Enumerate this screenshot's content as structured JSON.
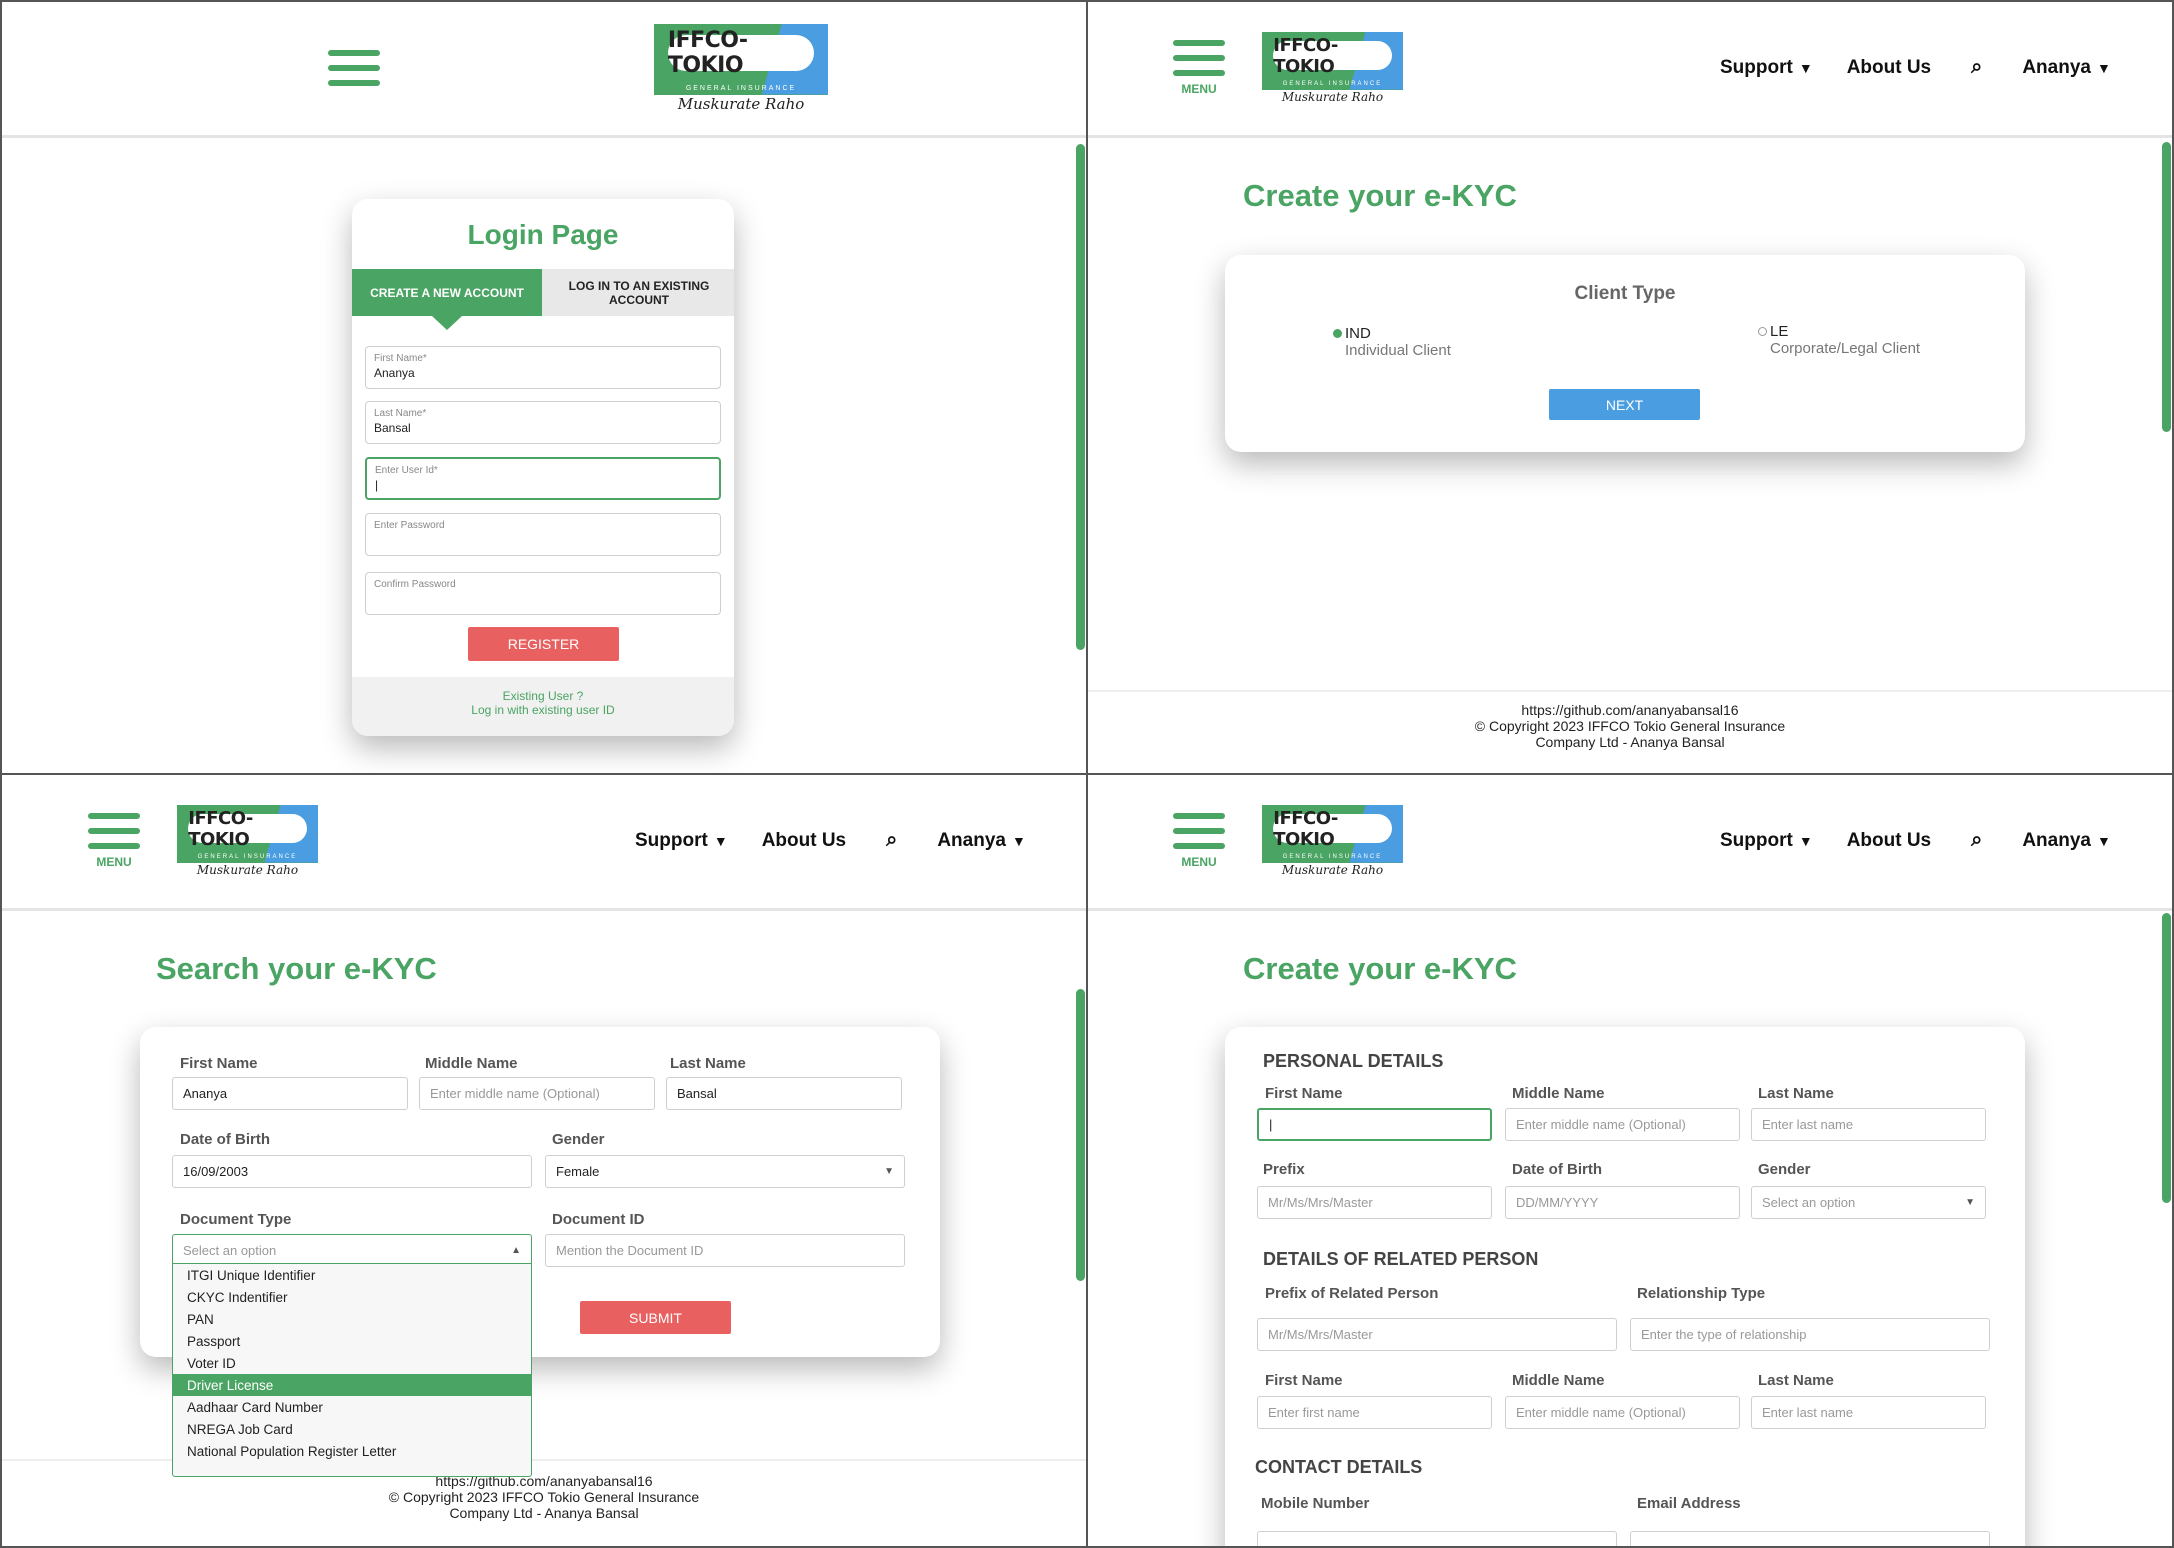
{
  "brand": {
    "logo_text": "IFFCO-TOKIO",
    "logo_sub": "GENERAL INSURANCE",
    "logo_tag": "Muskurate Raho",
    "green": "#4aa463",
    "blue": "#4a9de0",
    "red": "#e86060"
  },
  "nav": {
    "menu_label": "MENU",
    "support": "Support",
    "about": "About Us",
    "user": "Ananya",
    "caret": "▼",
    "search_icon": "🔍"
  },
  "footer": {
    "line1": "https://github.com/ananyabansal16",
    "line2": "© Copyright 2023 IFFCO Tokio General Insurance",
    "line3": "Company Ltd - Ananya Bansal"
  },
  "login": {
    "title": "Login Page",
    "tab_create": "CREATE A NEW ACCOUNT",
    "tab_login": "LOG IN TO AN EXISTING ACCOUNT",
    "first_name_label": "First Name*",
    "first_name_value": "Ananya",
    "last_name_label": "Last Name*",
    "last_name_value": "Bansal",
    "user_id_label": "Enter User Id*",
    "user_id_value": "|",
    "password_label": "Enter Password",
    "confirm_label": "Confirm Password",
    "register": "REGISTER",
    "existing_1": "Existing User ?",
    "existing_2": "Log in with existing user ID"
  },
  "client": {
    "title": "Create your e-KYC",
    "heading": "Client Type",
    "ind_code": "IND",
    "ind_desc": "Individual Client",
    "le_code": "LE",
    "le_desc": "Corporate/Legal Client",
    "next": "NEXT",
    "selected": "IND"
  },
  "search": {
    "title": "Search your e-KYC",
    "first_name_label": "First Name",
    "first_name_value": "Ananya",
    "middle_name_label": "Middle Name",
    "middle_name_placeholder": "Enter middle name (Optional)",
    "last_name_label": "Last Name",
    "last_name_value": "Bansal",
    "dob_label": "Date of Birth",
    "dob_value": "16/09/2003",
    "gender_label": "Gender",
    "gender_value": "Female",
    "doc_type_label": "Document Type",
    "doc_type_placeholder": "Select an option",
    "doc_id_label": "Document ID",
    "doc_id_placeholder": "Mention the Document ID",
    "submit": "SUBMIT",
    "options": [
      "ITGI Unique Identifier",
      "CKYC Indentifier",
      "PAN",
      "Passport",
      "Voter ID",
      "Driver License",
      "Aadhaar Card Number",
      "NREGA Job Card",
      "National Population Register Letter"
    ],
    "highlighted_option": "Driver License"
  },
  "form": {
    "title": "Create your e-KYC",
    "personal_h": "PERSONAL DETAILS",
    "first_name_label": "First Name",
    "middle_name_label": "Middle Name",
    "middle_name_placeholder": "Enter middle name (Optional)",
    "last_name_label": "Last Name",
    "last_name_placeholder": "Enter last name",
    "prefix_label": "Prefix",
    "prefix_placeholder": "Mr/Ms/Mrs/Master",
    "dob_label": "Date of Birth",
    "dob_placeholder": "DD/MM/YYYY",
    "gender_label": "Gender",
    "gender_placeholder": "Select an option",
    "related_h": "DETAILS OF RELATED PERSON",
    "rel_prefix_label": "Prefix of Related Person",
    "rel_prefix_placeholder": "Mr/Ms/Mrs/Master",
    "rel_type_label": "Relationship Type",
    "rel_type_placeholder": "Enter the type of relationship",
    "rel_first_label": "First Name",
    "rel_first_placeholder": "Enter first name",
    "rel_middle_label": "Middle Name",
    "rel_middle_placeholder": "Enter middle name (Optional)",
    "rel_last_label": "Last Name",
    "rel_last_placeholder": "Enter last name",
    "contact_h": "CONTACT DETAILS",
    "mobile_label": "Mobile Number",
    "email_label": "Email Address"
  }
}
